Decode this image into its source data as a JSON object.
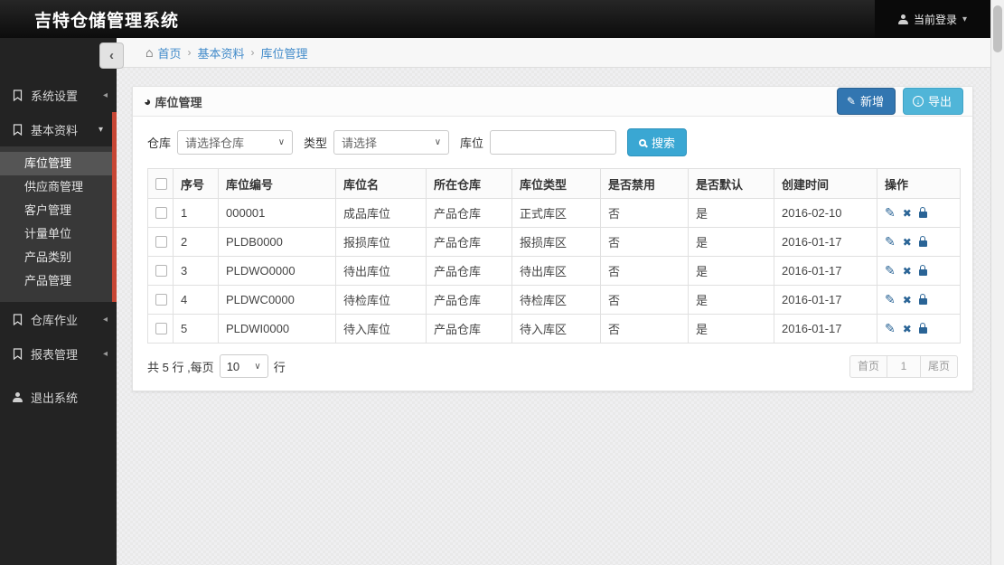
{
  "header": {
    "title": "吉特仓储管理系统",
    "user_label": "当前登录"
  },
  "breadcrumb": {
    "items": [
      "首页",
      "基本资料",
      "库位管理"
    ]
  },
  "sidebar": {
    "sections": [
      {
        "label": "系统设置"
      },
      {
        "label": "基本资料",
        "children": [
          "库位管理",
          "供应商管理",
          "客户管理",
          "计量单位",
          "产品类别",
          "产品管理"
        ],
        "active_child": "库位管理"
      },
      {
        "label": "仓库作业"
      },
      {
        "label": "报表管理"
      }
    ],
    "logout_label": "退出系统"
  },
  "panel": {
    "title": "库位管理",
    "buttons": {
      "add": "新增",
      "export": "导出",
      "search": "搜索"
    },
    "filters": {
      "warehouse_label": "仓库",
      "warehouse_value": "请选择仓库",
      "type_label": "类型",
      "type_value": "请选择",
      "location_label": "库位",
      "location_value": ""
    },
    "table": {
      "columns": [
        "序号",
        "库位编号",
        "库位名",
        "所在仓库",
        "库位类型",
        "是否禁用",
        "是否默认",
        "创建时间",
        "操作"
      ],
      "rows": [
        {
          "seq": "1",
          "code": "000001",
          "name": "成品库位",
          "warehouse": "产品仓库",
          "type": "正式库区",
          "disabled": "否",
          "default": "是",
          "created": "2016-02-10"
        },
        {
          "seq": "2",
          "code": "PLDB0000",
          "name": "报损库位",
          "warehouse": "产品仓库",
          "type": "报损库区",
          "disabled": "否",
          "default": "是",
          "created": "2016-01-17"
        },
        {
          "seq": "3",
          "code": "PLDWO0000",
          "name": "待出库位",
          "warehouse": "产品仓库",
          "type": "待出库区",
          "disabled": "否",
          "default": "是",
          "created": "2016-01-17"
        },
        {
          "seq": "4",
          "code": "PLDWC0000",
          "name": "待检库位",
          "warehouse": "产品仓库",
          "type": "待检库区",
          "disabled": "否",
          "default": "是",
          "created": "2016-01-17"
        },
        {
          "seq": "5",
          "code": "PLDWI0000",
          "name": "待入库位",
          "warehouse": "产品仓库",
          "type": "待入库区",
          "disabled": "否",
          "default": "是",
          "created": "2016-01-17"
        }
      ]
    },
    "footer": {
      "total_prefix": "共 5 行 ,每页",
      "page_size": "10",
      "total_suffix": "行",
      "pagination": [
        "首页",
        "1",
        "尾页"
      ]
    }
  },
  "icons": {
    "home": "⌂",
    "breadcrumb_sep": "›",
    "caret_down": "▾",
    "caret_left": "◂",
    "collapse": "‹",
    "pencil": "✎",
    "export_arrow": "↓",
    "select_caret": "∨",
    "edit": "✎",
    "delete": "✖",
    "panel_circle": "◕"
  },
  "colors": {
    "header_bg": "#111111",
    "sidebar_bg": "#232323",
    "sidebar_accent": "#c74634",
    "link": "#428bca",
    "add_button": "#3276b1",
    "export_button": "#50b5d8",
    "search_button": "#3aa7d3",
    "op_icon": "#2a6496"
  }
}
